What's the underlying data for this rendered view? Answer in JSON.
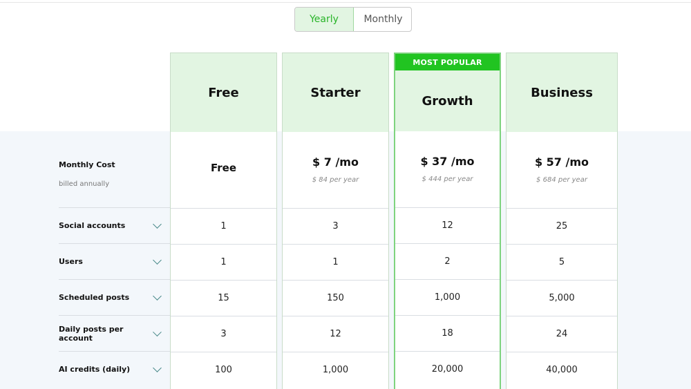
{
  "billing_toggle": {
    "yearly": "Yearly",
    "monthly": "Monthly",
    "selected": "Yearly"
  },
  "labels": {
    "monthly_cost": "Monthly Cost",
    "billed_note": "billed annually",
    "rows": [
      "Social accounts",
      "Users",
      "Scheduled posts",
      "Daily posts per account",
      "AI credits (daily)"
    ]
  },
  "popular_badge": "MOST POPULAR",
  "plans": [
    {
      "name": "Free",
      "price": "Free",
      "per_year": "",
      "values": [
        "1",
        "1",
        "15",
        "3",
        "100"
      ]
    },
    {
      "name": "Starter",
      "price": "$ 7 /mo",
      "per_year": "$ 84 per year",
      "values": [
        "3",
        "1",
        "150",
        "12",
        "1,000"
      ]
    },
    {
      "name": "Growth",
      "price": "$ 37 /mo",
      "per_year": "$ 444 per year",
      "values": [
        "12",
        "2",
        "1,000",
        "18",
        "20,000"
      ]
    },
    {
      "name": "Business",
      "price": "$ 57 /mo",
      "per_year": "$ 684 per year",
      "values": [
        "25",
        "5",
        "5,000",
        "24",
        "40,000"
      ]
    }
  ],
  "colors": {
    "accent_green": "#21c421",
    "header_bg": "#e2f5e2",
    "band_bg": "#f3f7fb"
  }
}
